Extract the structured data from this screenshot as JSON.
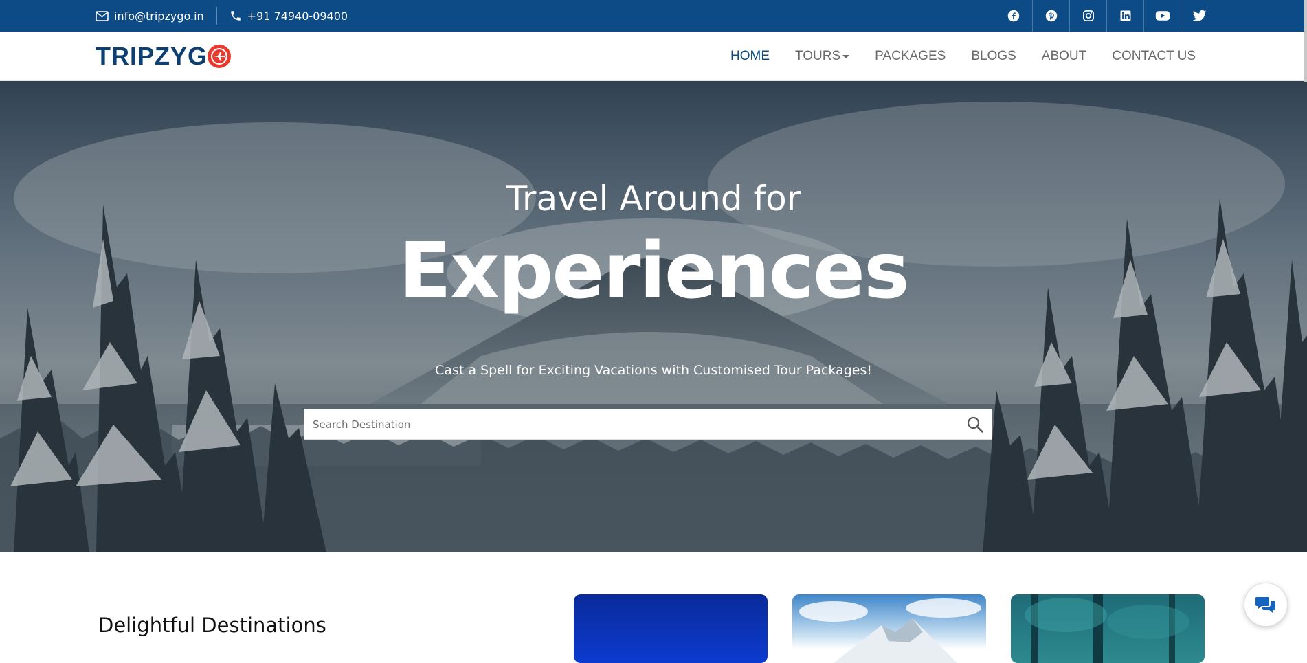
{
  "topbar": {
    "email": "info@tripzygo.in",
    "phone": "+91 74940-09400",
    "socials": [
      "facebook-icon",
      "pinterest-icon",
      "instagram-icon",
      "linkedin-icon",
      "youtube-icon",
      "twitter-icon"
    ]
  },
  "brand": {
    "name_part1": "TRIPZYG",
    "name_part2": "O"
  },
  "nav": {
    "items": [
      {
        "label": "HOME",
        "active": true
      },
      {
        "label": "TOURS",
        "active": false,
        "has_dropdown": true
      },
      {
        "label": "PACKAGES",
        "active": false
      },
      {
        "label": "BLOGS",
        "active": false
      },
      {
        "label": "ABOUT",
        "active": false
      },
      {
        "label": "CONTACT US",
        "active": false
      }
    ]
  },
  "hero": {
    "title_small": "Travel Around for",
    "title_big": "Experiences",
    "subtitle": "Cast a Spell for Exciting Vacations with Customised Tour Packages!",
    "search_placeholder": "Search Destination"
  },
  "section": {
    "title": "Delightful Destinations"
  },
  "colors": {
    "topbar": "#0d4b86",
    "brand_blue": "#0d3f73",
    "brand_red": "#e8392f",
    "nav_active": "#0d4b86",
    "chat_icon": "#1565c0"
  }
}
